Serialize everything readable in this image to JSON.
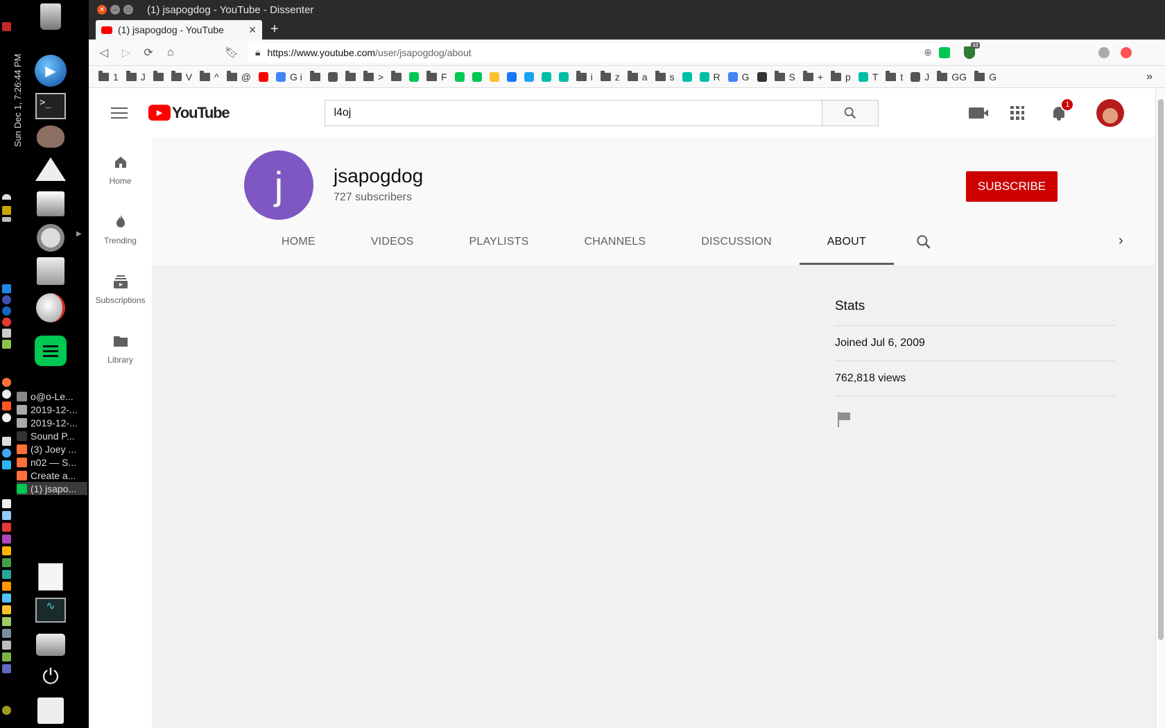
{
  "desktop": {
    "clock": "Sun Dec  1,  7:26:44 PM",
    "taskbar": [
      {
        "label": "o@o-Le...",
        "color": "#888"
      },
      {
        "label": "2019-12-...",
        "color": "#aaa"
      },
      {
        "label": "2019-12-...",
        "color": "#aaa"
      },
      {
        "label": "Sound P...",
        "color": "#333"
      },
      {
        "label": "(3) Joey ...",
        "color": "#ff7139"
      },
      {
        "label": "n02 — S...",
        "color": "#ff7139"
      },
      {
        "label": "Create a...",
        "color": "#ff7139"
      },
      {
        "label": "(1) jsapo...",
        "color": "#00c853"
      }
    ]
  },
  "browser": {
    "title": "(1) jsapogdog - YouTube - Dissenter",
    "tab_title": "(1) jsapogdog - YouTube",
    "new_tab": "+",
    "url_prefix": "https://www.youtube.com",
    "url_path": "/user/jsapogdog/about",
    "ext_badge": "48",
    "bookmarks": [
      "1",
      "J",
      "",
      "V",
      "^",
      "@",
      "",
      "G i",
      "",
      "",
      "",
      ">",
      "",
      "",
      "F",
      "",
      "",
      "",
      "",
      "",
      "",
      "",
      "i",
      "z",
      "a",
      "s",
      "",
      "R",
      "G",
      "",
      "S",
      "+",
      "p",
      "T",
      "t",
      "J",
      "GG",
      "G"
    ],
    "overflow": "»"
  },
  "youtube": {
    "logo_text": "YouTube",
    "search_value": "l4oj",
    "notification_count": "1",
    "guide": [
      {
        "label": "Home",
        "icon": "home-icon"
      },
      {
        "label": "Trending",
        "icon": "fire-icon"
      },
      {
        "label": "Subscriptions",
        "icon": "subscriptions-icon"
      },
      {
        "label": "Library",
        "icon": "folder-icon"
      }
    ],
    "channel": {
      "avatar_letter": "j",
      "avatar_color": "#7e57c2",
      "name": "jsapogdog",
      "subscribers": "727 subscribers",
      "subscribe_label": "SUBSCRIBE",
      "subscribe_color": "#cc0000"
    },
    "tabs": [
      "HOME",
      "VIDEOS",
      "PLAYLISTS",
      "CHANNELS",
      "DISCUSSION",
      "ABOUT"
    ],
    "selected_tab": "ABOUT",
    "stats": {
      "heading": "Stats",
      "joined": "Joined Jul 6, 2009",
      "views": "762,818 views"
    }
  }
}
